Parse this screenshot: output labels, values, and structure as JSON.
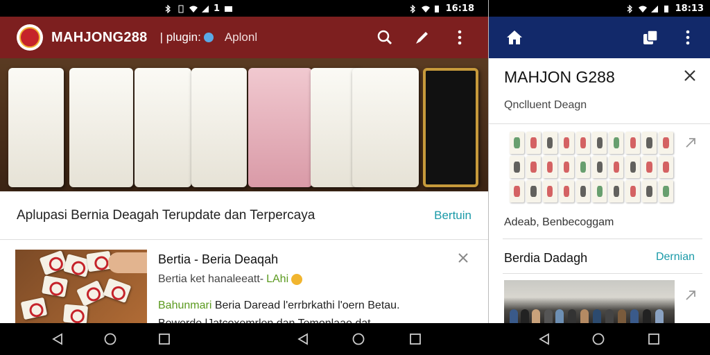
{
  "left_status": {
    "time": "1"
  },
  "mid_status": {
    "time": "16:18"
  },
  "right_status": {
    "time": "18:13"
  },
  "left": {
    "app_title": "MAHJONG288",
    "app_sub_a": "| plugin:",
    "app_sub_b": "Aplonl",
    "headline": "Aplupasi Bernia Deagah Terupdate dan Terpercaya",
    "headline_link": "Bertuin",
    "card": {
      "title": "Bertia - Beria Deaqah",
      "meta_a": "Bertia ket hanaleeatt- ",
      "meta_b": "LAhi",
      "body_lead": "Bahunmari",
      "body_rest": " Beria Daread l'errbrkathi l'oern Betau.",
      "body_line2": "Bewerde lJatcoxemrlen dan Temonlaae dat"
    }
  },
  "right": {
    "title": "MAHJON G288",
    "subtitle": "Qnclluent Deagn",
    "caption": "Adeab, Benbecoggam",
    "section_title": "Berdia Dadagh",
    "section_link": "Dernian"
  },
  "colors": {
    "left_appbar": "#7d1f1f",
    "right_appbar": "#12296a",
    "accent_link": "#1a9aa8"
  },
  "icons": {
    "left_actions": [
      "search-icon",
      "edit-pen-icon",
      "more-vert-icon"
    ],
    "right_actions": [
      "home-icon",
      "cards-icon",
      "more-vert-icon"
    ],
    "nav": [
      "back-icon",
      "home-circle-icon",
      "recents-icon"
    ]
  }
}
